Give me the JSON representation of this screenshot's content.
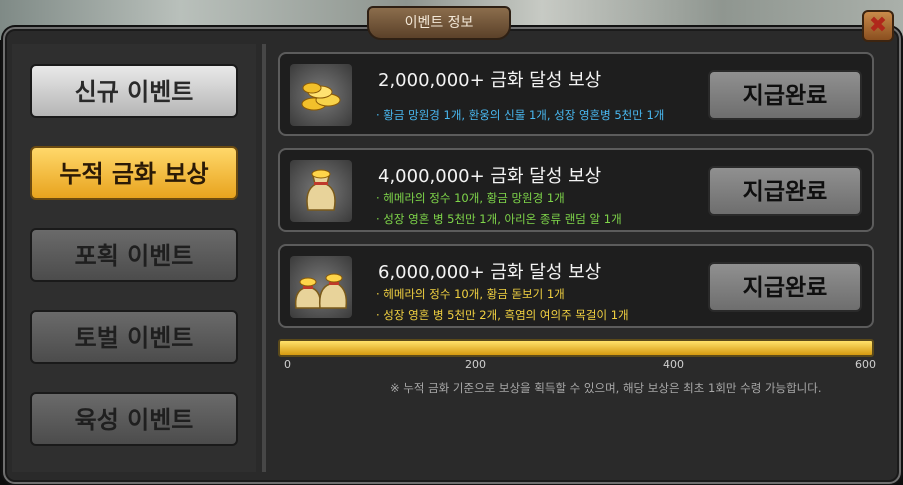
{
  "window": {
    "title": "이벤트 정보",
    "close_label": "✖"
  },
  "sidebar": {
    "items": [
      {
        "label": "신규 이벤트",
        "state": "normal"
      },
      {
        "label": "누적 금화 보상",
        "state": "selected"
      },
      {
        "label": "포획 이벤트",
        "state": "disabled"
      },
      {
        "label": "토벌 이벤트",
        "state": "disabled"
      },
      {
        "label": "육성 이벤트",
        "state": "disabled"
      }
    ]
  },
  "rewards": [
    {
      "title": "2,000,000+ 금화 달성 보상",
      "lines": [
        "· 황금 망원경 1개, 환웅의 신물 1개, 성장 영혼병 5천만 1개"
      ],
      "line_color": "#49b8f0",
      "icon": "gold-coins-icon",
      "button": "지급완료"
    },
    {
      "title": "4,000,000+ 금화 달성 보상",
      "lines": [
        "· 헤메라의 정수 10개, 황금 망원경 1개",
        "· 성장 영혼 병 5천만 1개, 아리온 종류 랜덤 알 1개"
      ],
      "line_color": "#7fd64a",
      "icon": "gold-sack-icon",
      "button": "지급완료"
    },
    {
      "title": "6,000,000+ 금화 달성 보상",
      "lines": [
        "· 헤메라의 정수 10개, 황금 돋보기 1개",
        "· 성장 영혼 병 5천만 2개, 흑염의 여의주 목걸이 1개"
      ],
      "line_color": "#f1d141",
      "icon": "gold-sacks-icon",
      "button": "지급완료"
    }
  ],
  "progress": {
    "value": 600,
    "max": 600,
    "ticks": [
      "0",
      "200",
      "400",
      "600"
    ]
  },
  "notice": "※ 누적 금화 기준으로 보상을 획득할 수 있으며, 해당 보상은 최초 1회만 수령 가능합니다."
}
